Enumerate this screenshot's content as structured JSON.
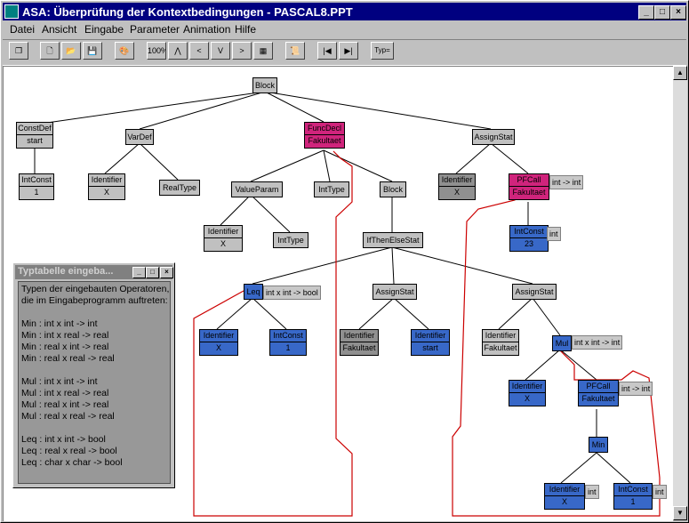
{
  "window": {
    "title": "ASA: Überprüfung der Kontextbedingungen - PASCAL8.PPT",
    "controls": {
      "minimize": "_",
      "maximize": "□",
      "close": "×"
    }
  },
  "menu": [
    "Datei",
    "Ansicht",
    "Eingabe",
    "Parameter",
    "Animation",
    "Hilfe"
  ],
  "toolbar": {
    "buttons": [
      {
        "name": "copy-icon",
        "glyph": "❐"
      },
      {
        "name": "new-icon",
        "glyph": "🗋"
      },
      {
        "name": "open-icon",
        "glyph": "📂"
      },
      {
        "name": "save-icon",
        "glyph": "💾"
      },
      {
        "name": "palette-icon",
        "glyph": "🎨"
      },
      {
        "name": "zoom-icon",
        "glyph": "100%"
      },
      {
        "name": "tree-top-icon",
        "glyph": "⋀"
      },
      {
        "name": "tree-left-icon",
        "glyph": "<"
      },
      {
        "name": "tree-down-icon",
        "glyph": "V"
      },
      {
        "name": "tree-right-icon",
        "glyph": ">"
      },
      {
        "name": "layout-icon",
        "glyph": "▦"
      },
      {
        "name": "script-icon",
        "glyph": "📜"
      },
      {
        "name": "first-icon",
        "glyph": "|◀"
      },
      {
        "name": "last-icon",
        "glyph": "▶|"
      },
      {
        "name": "type-icon",
        "glyph": "Typ="
      }
    ]
  },
  "tree": {
    "nodes": [
      {
        "id": "block",
        "top": "Block",
        "color": "gray"
      },
      {
        "id": "constdef",
        "top": "ConstDef",
        "bottom": "start",
        "color": "gray"
      },
      {
        "id": "vardef",
        "top": "VarDef",
        "color": "gray"
      },
      {
        "id": "funcdecl",
        "top": "FuncDecl",
        "bottom": "Fakultaet",
        "color": "pink"
      },
      {
        "id": "assign1",
        "top": "AssignStat",
        "color": "gray"
      },
      {
        "id": "intconst1",
        "top": "IntConst",
        "bottom": "1",
        "color": "gray"
      },
      {
        "id": "ident1",
        "top": "Identifier",
        "bottom": "X",
        "color": "gray"
      },
      {
        "id": "realtype",
        "top": "RealType",
        "color": "gray"
      },
      {
        "id": "valueparam",
        "top": "ValueParam",
        "color": "gray"
      },
      {
        "id": "inttype1",
        "top": "IntType",
        "color": "gray"
      },
      {
        "id": "block2",
        "top": "Block",
        "color": "gray"
      },
      {
        "id": "ident2",
        "top": "Identifier",
        "bottom": "X",
        "color": "dark"
      },
      {
        "id": "pfcall1",
        "top": "PFCall",
        "bottom": "Fakultaet",
        "color": "pink"
      },
      {
        "id": "ident3",
        "top": "Identifier",
        "bottom": "X",
        "color": "gray"
      },
      {
        "id": "inttype2",
        "top": "IntType",
        "color": "gray"
      },
      {
        "id": "ifthenelse",
        "top": "IfThenElseStat",
        "color": "gray"
      },
      {
        "id": "intconst2",
        "top": "IntConst",
        "bottom": "23",
        "color": "blue"
      },
      {
        "id": "leq",
        "top": "Leq",
        "color": "blue"
      },
      {
        "id": "assign2",
        "top": "AssignStat",
        "color": "gray"
      },
      {
        "id": "assign3",
        "top": "AssignStat",
        "color": "gray"
      },
      {
        "id": "ident4",
        "top": "Identifier",
        "bottom": "X",
        "color": "blue"
      },
      {
        "id": "intconst3",
        "top": "IntConst",
        "bottom": "1",
        "color": "blue"
      },
      {
        "id": "ident5",
        "top": "Identifier",
        "bottom": "Fakultaet",
        "color": "dark"
      },
      {
        "id": "ident6",
        "top": "Identifier",
        "bottom": "start",
        "color": "blue"
      },
      {
        "id": "ident7",
        "top": "Identifier",
        "bottom": "Fakultaet",
        "color": "gray"
      },
      {
        "id": "mul",
        "top": "Mul",
        "color": "blue"
      },
      {
        "id": "ident8",
        "top": "Identifier",
        "bottom": "X",
        "color": "blue"
      },
      {
        "id": "pfcall2",
        "top": "PFCall",
        "bottom": "Fakultaet",
        "color": "blue"
      },
      {
        "id": "min",
        "top": "Min",
        "color": "blue"
      },
      {
        "id": "ident9",
        "top": "Identifier",
        "bottom": "X",
        "color": "blue"
      },
      {
        "id": "intconst4",
        "top": "IntConst",
        "bottom": "1",
        "color": "blue"
      }
    ],
    "tags": [
      {
        "id": "tag-pfcall1",
        "text": "int -> int"
      },
      {
        "id": "tag-intconst2",
        "text": "int"
      },
      {
        "id": "tag-leq",
        "text": "int x int -> bool"
      },
      {
        "id": "tag-mul",
        "text": "int x int -> int"
      },
      {
        "id": "tag-pfcall2",
        "text": "int -> int"
      },
      {
        "id": "tag-ident9",
        "text": "int"
      },
      {
        "id": "tag-intconst4",
        "text": "int"
      }
    ]
  },
  "popup": {
    "title": "Typtabelle eingeba...",
    "lines": [
      "Typen der eingebauten Operatoren,",
      "die im Eingabeprogramm auftreten:",
      "",
      "Min : int x int -> int",
      "Min : int x real -> real",
      "Min : real x int -> real",
      "Min : real x real -> real",
      "",
      "Mul : int x int -> int",
      "Mul : int x real -> real",
      "Mul : real x int -> real",
      "Mul : real x real -> real",
      "",
      "Leq : int x int -> bool",
      "Leq : real x real -> bool",
      "Leq : char x char -> bool"
    ]
  }
}
